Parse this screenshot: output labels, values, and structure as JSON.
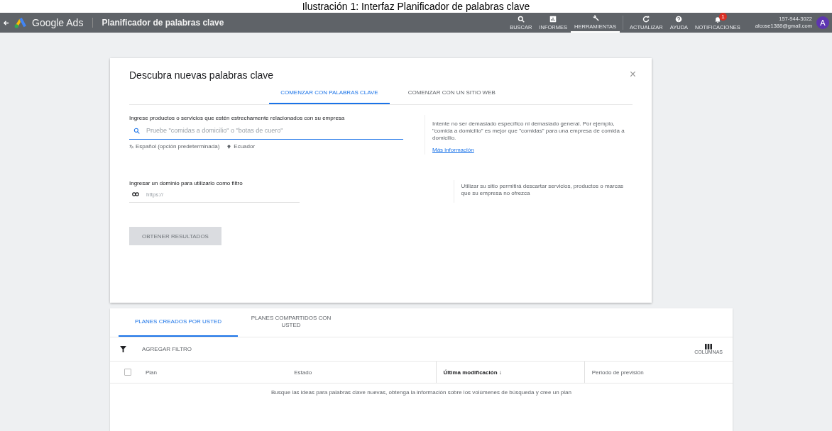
{
  "caption": "Ilustración 1: Interfaz Planificador de palabras clave",
  "topbar": {
    "product": "Google Ads",
    "page_title": "Planificador de palabras clave",
    "nav": [
      {
        "kind": "search",
        "label": "BUSCAR"
      },
      {
        "kind": "reports",
        "label": "INFORMES"
      },
      {
        "kind": "tools",
        "label": "HERRAMIENTAS",
        "selected": true
      },
      {
        "kind": "refresh",
        "label": "ACTUALIZAR",
        "selected": false
      },
      {
        "kind": "help",
        "label": "AYUDA",
        "selected": false
      },
      {
        "kind": "bell",
        "label": "NOTIFICACIONES",
        "badge": "1",
        "selected": false
      }
    ],
    "account": {
      "id": "157-944-3022",
      "email": "alcose1388@gmail.com",
      "avatar": "A"
    }
  },
  "discover": {
    "title": "Descubra nuevas palabras clave",
    "close": "×",
    "tabs": [
      {
        "label": "COMENZAR CON PALABRAS CLAVE",
        "selected": true
      },
      {
        "label": "COMENZAR CON UN SITIO WEB",
        "selected": false
      }
    ],
    "keywords": {
      "label": "Ingrese productos o servicios que estén estrechamente relacionados con su empresa",
      "placeholder": "Pruebe \"comidas a domicilio\" o \"botas de cuero\"",
      "language": "Español (opción predeterminada)",
      "location": "Ecuador",
      "tip": "Intente no ser demasiado específico ni demasiado general. Por ejemplo, \"comida a domicilio\" es mejor que \"comidas\" para una empresa de comida a domicilio.",
      "link": "Más información"
    },
    "domain": {
      "label": "Ingresar un dominio para utilizarlo como filtro",
      "placeholder": "https://",
      "tip": "Utilizar su sitio permitirá descartar servicios, productos o marcas que su empresa no ofrezca"
    },
    "submit": {
      "label": "OBTENER RESULTADOS",
      "disabled": true
    }
  },
  "plans": {
    "tabs": [
      {
        "label": "PLANES CREADOS POR USTED",
        "selected": true
      },
      {
        "label": "PLANES COMPARTIDOS CON USTED",
        "selected": false
      }
    ],
    "filter": "AGREGAR FILTRO",
    "columns_button": "COLUMNAS",
    "table": {
      "select_all": {
        "checked": false
      },
      "columns": [
        {
          "label": "Plan",
          "sorted": false
        },
        {
          "label": "Estado",
          "sorted": false
        },
        {
          "label": "Última modificación",
          "sorted": true,
          "sort_icon": "↓"
        },
        {
          "label": "Periodo de previsión",
          "sorted": false
        }
      ],
      "empty_message": "Busque las ideas para palabras clave nuevas, obtenga la información sobre los volúmenes de búsqueda y cree un plan"
    }
  }
}
